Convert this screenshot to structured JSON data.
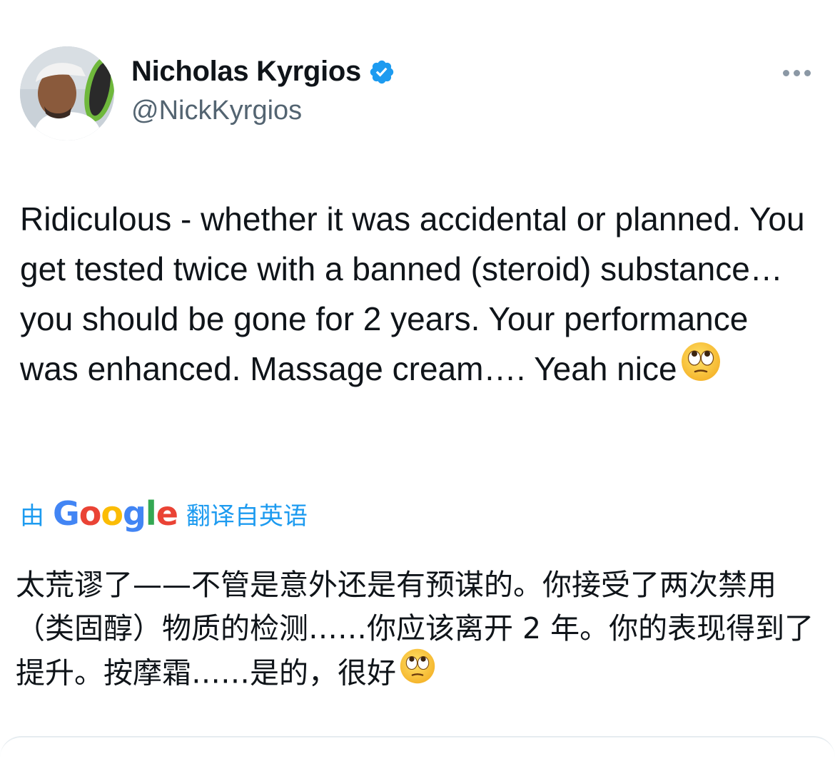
{
  "author": {
    "display_name": "Nicholas Kyrgios",
    "handle": "@NickKyrgios",
    "verified_icon": "verified-badge-icon",
    "badge_color": "#1d9bf0"
  },
  "tweet": {
    "text": "Ridiculous - whether it was accidental or planned. You get tested twice with a banned (steroid) substance… you should be gone for 2 years. Your performance was enhanced. Massage cream…. Yeah nice",
    "emoji": "face-with-rolling-eyes"
  },
  "translation": {
    "prefix": "由",
    "provider_logo": "Google",
    "suffix": "翻译自英语",
    "text": "太荒谬了——不管是意外还是有预谋的。你接受了两次禁用（类固醇）物质的检测……你应该离开 2 年。你的表现得到了提升。按摩霜……是的，很好",
    "link_color": "#1d9bf0"
  }
}
